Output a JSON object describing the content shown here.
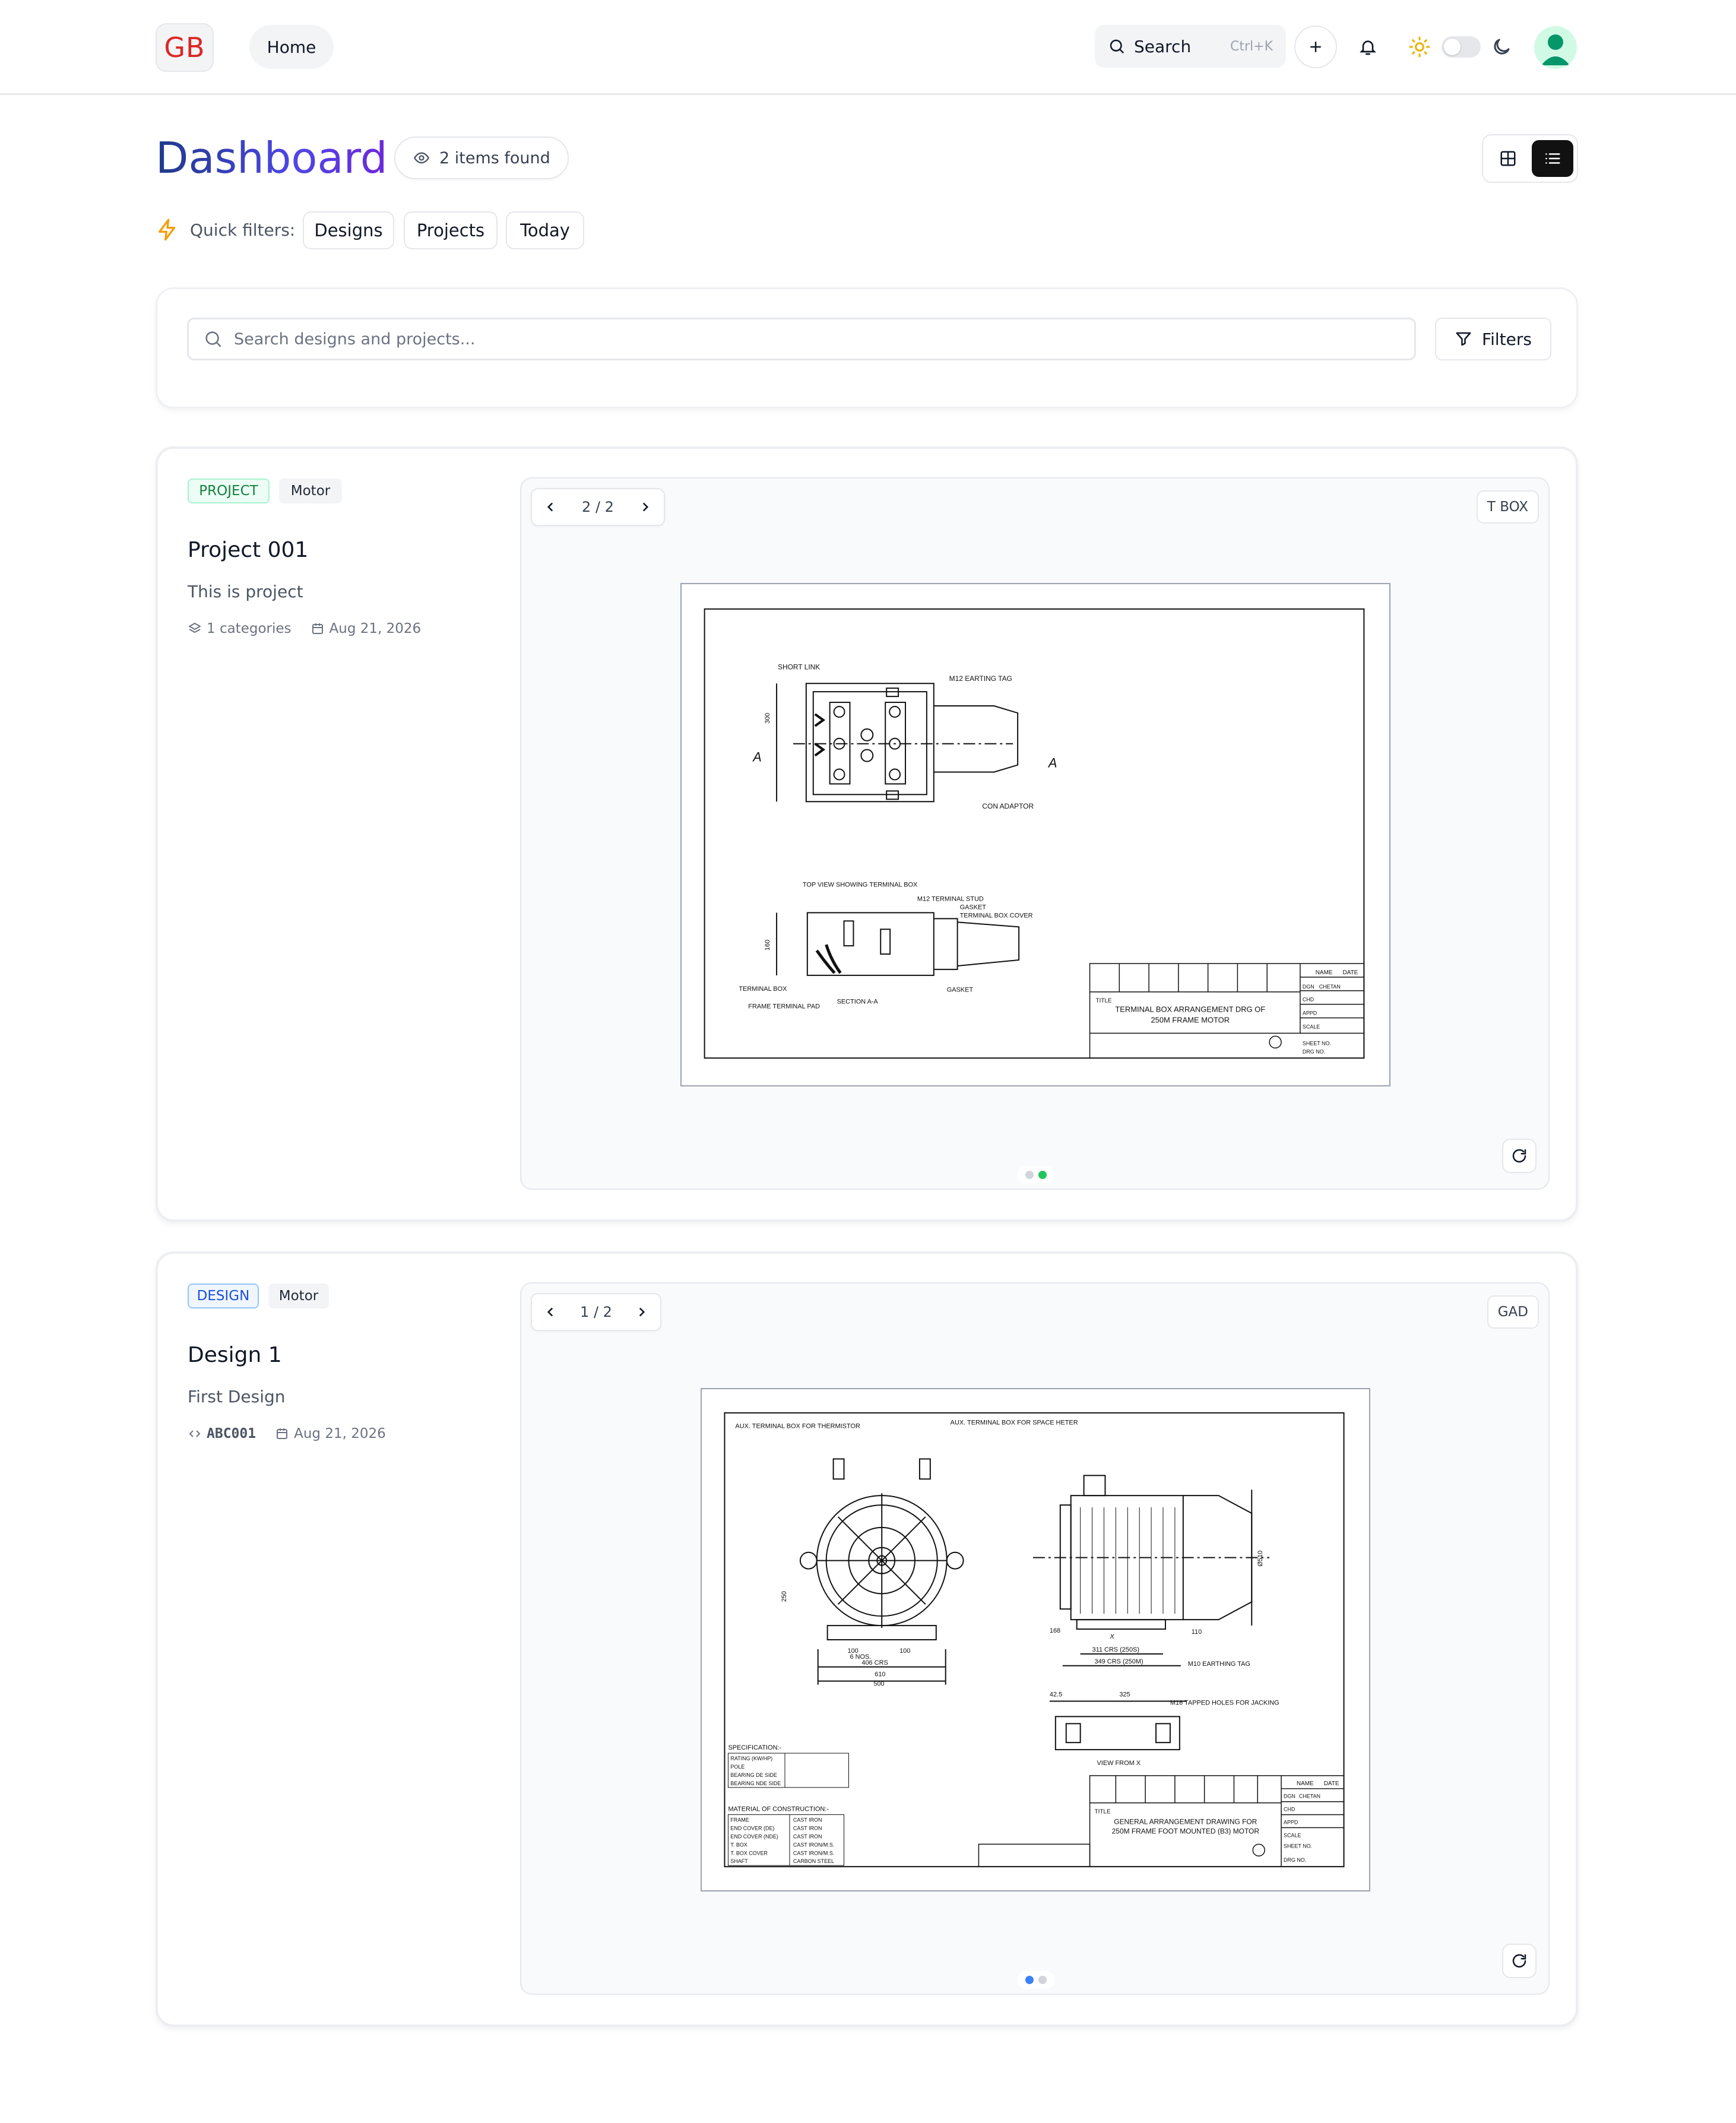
{
  "header": {
    "logo_text": "GB",
    "home_label": "Home",
    "search_label": "Search",
    "search_shortcut": "Ctrl+K"
  },
  "page": {
    "title": "Dashboard",
    "items_found": "2 items found",
    "quick_filters_label": "Quick filters:",
    "quick_filters": [
      "Designs",
      "Projects",
      "Today"
    ]
  },
  "search": {
    "placeholder": "Search designs and projects...",
    "filters_label": "Filters"
  },
  "items": [
    {
      "type": "PROJECT",
      "category": "Motor",
      "title": "Project 001",
      "description": "This is project",
      "meta_primary": "1 categories",
      "date": "Aug 21, 2026",
      "pager": "2 / 2",
      "sheet_tag": "T BOX",
      "drawing": {
        "labels": [
          "SHORT LINK",
          "M12 EARTING TAG",
          "CON ADAPTOR",
          "TOP VIEW SHOWING TERMINAL BOX",
          "M12 TERMINAL STUD",
          "GASKET",
          "TERMINAL BOX COVER",
          "TERMINAL BOX",
          "FRAME TERMINAL PAD",
          "SECTION A-A",
          "GASKET",
          "A",
          "A",
          "300",
          "160"
        ],
        "title_lines": [
          "TERMINAL BOX ARRANGEMENT DRG OF",
          "250M FRAME MOTOR"
        ],
        "block": [
          "NAME",
          "DATE",
          "DGN",
          "CHETAN",
          "CHD",
          "APPD",
          "TITLE",
          "SCALE",
          "SHEET NO.",
          "DRG NO."
        ]
      }
    },
    {
      "type": "DESIGN",
      "category": "Motor",
      "title": "Design 1",
      "description": "First Design",
      "meta_primary": "ABC001",
      "date": "Aug 21, 2026",
      "pager": "1 / 2",
      "sheet_tag": "GAD",
      "drawing": {
        "labels": [
          "AUX. TERMINAL BOX FOR THERMISTOR",
          "AUX. TERMINAL BOX FOR SPACE HETER",
          "100",
          "100",
          "406 CRS",
          "500",
          "610",
          "6 NOS.",
          "250",
          "311 CRS (250S)",
          "349 CRS (250M)",
          "M10 EARTHING TAG",
          "M16 TAPPED HOLES FOR JACKING",
          "42.5",
          "325",
          "VIEW FROM X",
          "168",
          "110",
          "X",
          "Ø510"
        ],
        "spec_title": "SPECIFICATION:-",
        "spec_rows": [
          "RATING (KW/HP)",
          "POLE",
          "BEARING DE SIDE",
          "BEARING NDE SIDE"
        ],
        "material_title": "MATERIAL OF CONSTRUCTION:-",
        "material_rows": [
          [
            "FRAME",
            "CAST IRON"
          ],
          [
            "END COVER (DE)",
            "CAST IRON"
          ],
          [
            "END COVER (NDE)",
            "CAST IRON"
          ],
          [
            "T. BOX",
            "CAST IRON/M.S."
          ],
          [
            "T. BOX COVER",
            "CAST IRON/M.S."
          ],
          [
            "SHAFT",
            "CARBON STEEL"
          ]
        ],
        "title_lines": [
          "GENERAL ARRANGEMENT DRAWING FOR",
          "250M FRAME FOOT MOUNTED (B3) MOTOR"
        ],
        "block": [
          "NAME",
          "DATE",
          "DGN",
          "CHETAN",
          "CHD",
          "APPD",
          "TITLE",
          "SCALE",
          "SHEET NO.",
          "DRG NO."
        ]
      }
    }
  ],
  "colors": {
    "logo_red": "#dc2626",
    "title_gradient_start": "#1e3a8a",
    "title_gradient_end": "#6d28d9",
    "project_badge": "#15803d",
    "design_badge": "#1d4ed8",
    "active_dot_project": "#22c55e",
    "active_dot_design": "#3b82f6",
    "sun_icon": "#eab308",
    "quick_filter_icon": "#f59e0b",
    "avatar": "#059669"
  },
  "icons": {
    "search": "search-icon",
    "add": "plus-icon",
    "notifications": "bell-icon",
    "light_theme": "sun-icon",
    "dark_theme": "moon-icon",
    "grid_view": "grid-icon",
    "list_view": "list-icon",
    "quick_filter": "lightning-icon",
    "filters": "funnel-icon",
    "items_found": "eye-icon",
    "refresh": "refresh-icon"
  }
}
